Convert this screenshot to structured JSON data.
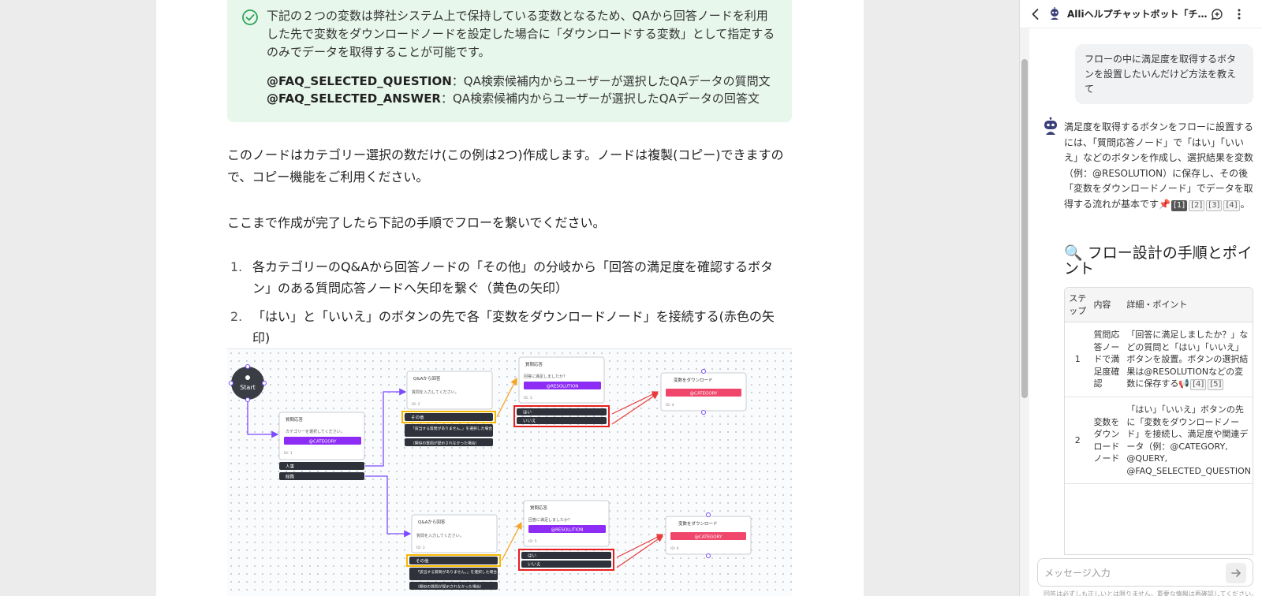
{
  "note": {
    "text": "下記の２つの変数は弊社システム上で保持している変数となるため、QAから回答ノードを利用した先で変数をダウンロードノードを設定した場合に「ダウンロードする変数」として指定するのみでデータを取得することが可能です。",
    "var1_name": "@FAQ_SELECTED_QUESTION",
    "var1_desc": "：QA検索候補内からユーザーが選択したQAデータの質問文",
    "var2_name": "@FAQ_SELECTED_ANSWER",
    "var2_desc": "：QA検索候補内からユーザーが選択したQAデータの回答文"
  },
  "article": {
    "para1": "このノードはカテゴリー選択の数だけ(この例は2つ)作成します。ノードは複製(コピー)できますので、コピー機能をご利用ください。",
    "para2": "ここまで作成が完了したら下記の手順でフローを繋いでください。",
    "steps": [
      {
        "num": "1.",
        "text": "各カテゴリーのQ&Aから回答ノードの「その他」の分岐から「回答の満足度を確認するボタン」のある質問応答ノードへ矢印を繋ぐ（黄色の矢印）"
      },
      {
        "num": "2.",
        "text": "「はい」と「いいえ」のボタンの先で各「変数をダウンロードノード」を接続する(赤色の矢印)"
      }
    ]
  },
  "diagram": {
    "start": "Start",
    "question_node": {
      "title": "質問応答",
      "prompt": "カテゴリーを選択してください。",
      "var": "@CATEGORY",
      "id": "ID: 1",
      "options": [
        "人事",
        "総務"
      ]
    },
    "qa_nodes": [
      {
        "title": "Q&Aから回答",
        "prompt": "質問を入力してください。",
        "id": "ID: 2",
        "options": [
          "その他",
          "「該当する質問がありません。」を選択した場合",
          "（類似の質問が提示されなかった場合）"
        ]
      },
      {
        "title": "Q&Aから回答",
        "prompt": "質問を入力してください。",
        "id": "ID: 3",
        "options": [
          "その他",
          "「該当する質問がありません。」を選択した場合",
          "（類似の質問が提示されなかった場合）"
        ]
      }
    ],
    "satisfaction_nodes": [
      {
        "title": "質問応答",
        "prompt": "回答に満足しましたか？",
        "var": "@RESOLUTION",
        "id": "ID: 3",
        "options": [
          "はい",
          "いいえ"
        ]
      },
      {
        "title": "質問応答",
        "prompt": "回答に満足しましたか？",
        "var": "@RESOLUTION",
        "id": "ID: 5",
        "options": [
          "はい",
          "いいえ"
        ]
      }
    ],
    "download_nodes": [
      {
        "title": "変数をダウンロード",
        "var": "@CATEGORY",
        "id": "ID: 4"
      },
      {
        "title": "変数をダウンロード",
        "var": "@CATEGORY",
        "id": "ID: 6"
      }
    ]
  },
  "chat": {
    "title": "Alliヘルプチャットボット「チ…",
    "user_message": "フローの中に満足度を取得するボタンを設置したいんだけど方法を教えて",
    "bot_message": "満足度を取得するボタンをフローに設置するには、「質問応答ノード」で「はい」「いいえ」などのボタンを作成し、選択結果を変数（例：@RESOLUTION）に保存し、その後「変数をダウンロードノード」でデータを取得する流れが基本です📌",
    "bot_cites": [
      "[1]",
      "[2]",
      "[3]",
      "[4]"
    ],
    "section_icon": "🔍",
    "section_title": "フロー設計の手順とポイント",
    "table": {
      "headers": [
        "ステップ",
        "内容",
        "詳細・ポイント"
      ],
      "rows": [
        {
          "step": "1",
          "content": "質問応答ノードで満足度確認",
          "detail": "「回答に満足しましたか？」などの質問と「はい」「いいえ」ボタンを設置。ボタンの選択結果は@RESOLUTIONなどの変数に保存する📢",
          "cites": [
            "[4]",
            "[5]"
          ]
        },
        {
          "step": "2",
          "content": "変数をダウンロードノード",
          "detail": "「はい」「いいえ」ボタンの先に「変数をダウンロードノード」を接続し、満足度や関連データ（例：@CATEGORY, @QUERY, @FAQ_SELECTED_QUESTION",
          "cites": []
        }
      ]
    },
    "input_placeholder": "メッセージ入力",
    "disclaimer": "回答は必ずしも正しいとは限りません。重要な情報は再確認してください。"
  }
}
